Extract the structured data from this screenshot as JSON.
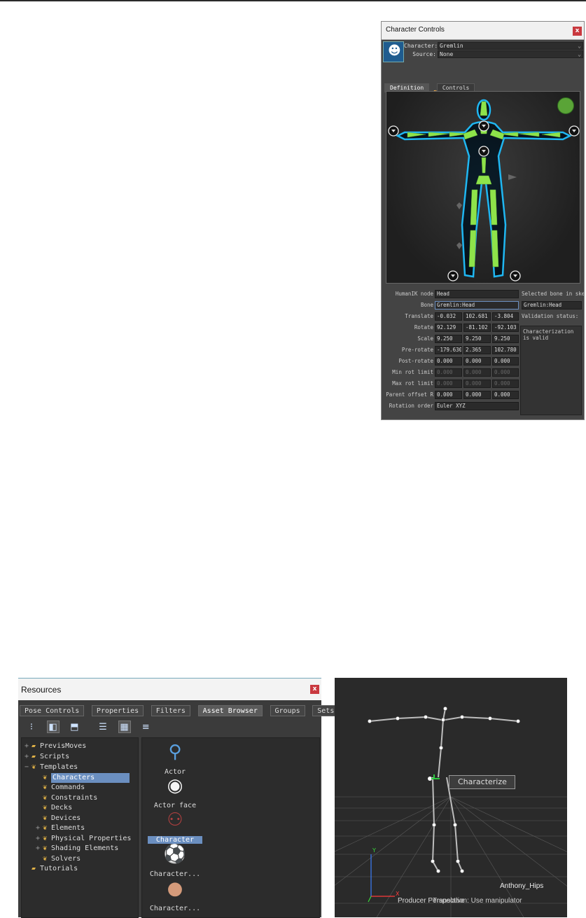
{
  "character_controls": {
    "title": "Character Controls",
    "close_label": "x",
    "character_label": "Character:",
    "character_value": "Gremlin",
    "source_label": "Source:",
    "source_value": "None",
    "tabs": [
      "Definition",
      "Controls"
    ],
    "form": {
      "humanik_node_label": "HumanIK node",
      "humanik_node_value": "Head",
      "selected_bone_label": "Selected bone in skel",
      "bone_label": "Bone",
      "bone_value": "Gremlin:Head",
      "selected_bone_value": "Gremlin:Head",
      "validation_label": "Validation status:",
      "validation_text": "Characterization\nis valid",
      "translate_label": "Translate",
      "translate": [
        "-0.032",
        "102.681",
        "-3.804"
      ],
      "rotate_label": "Rotate",
      "rotate": [
        "92.129",
        "-81.102",
        "-92.103"
      ],
      "scale_label": "Scale",
      "scale": [
        "9.250",
        "9.250",
        "9.250"
      ],
      "prerotate_label": "Pre-rotate",
      "prerotate": [
        "-179.630",
        "2.365",
        "102.780"
      ],
      "postrotate_label": "Post-rotate",
      "postrotate": [
        "0.000",
        "0.000",
        "0.000"
      ],
      "minrot_label": "Min rot limit",
      "minrot": [
        "0.000",
        "0.000",
        "0.000"
      ],
      "maxrot_label": "Max rot limit",
      "maxrot": [
        "0.000",
        "0.000",
        "0.000"
      ],
      "parent_offset_label": "Parent offset R",
      "parent_offset": [
        "0.000",
        "0.000",
        "0.000"
      ],
      "rotation_order_label": "Rotation order",
      "rotation_order_value": "Euler XYZ"
    }
  },
  "resources": {
    "title": "Resources",
    "close_label": "x",
    "tabs": [
      "Pose Controls",
      "Properties",
      "Filters",
      "Asset Browser",
      "Groups",
      "Sets"
    ],
    "active_tab": "Asset Browser",
    "tree": [
      {
        "label": "PrevisMoves",
        "expander": "+"
      },
      {
        "label": "Scripts",
        "expander": "+"
      },
      {
        "label": "Templates",
        "expander": "−"
      },
      {
        "label": "Characters",
        "expander": ""
      },
      {
        "label": "Commands",
        "expander": ""
      },
      {
        "label": "Constraints",
        "expander": ""
      },
      {
        "label": "Decks",
        "expander": ""
      },
      {
        "label": "Devices",
        "expander": ""
      },
      {
        "label": "Elements",
        "expander": "+"
      },
      {
        "label": "Physical Properties",
        "expander": "+"
      },
      {
        "label": "Shading Elements",
        "expander": "+"
      },
      {
        "label": "Solvers",
        "expander": ""
      },
      {
        "label": "Tutorials",
        "expander": ""
      }
    ],
    "assets": [
      "Actor",
      "Actor face",
      "Character",
      "Character...",
      "Character..."
    ]
  },
  "viewport": {
    "context_menu_item": "Characterize",
    "bone_name": "Anthony_Hips",
    "status_text": "Producer Perspective",
    "status_overlay": "Translation: Use manipulator",
    "axis_x": "X",
    "axis_y": "Y"
  }
}
